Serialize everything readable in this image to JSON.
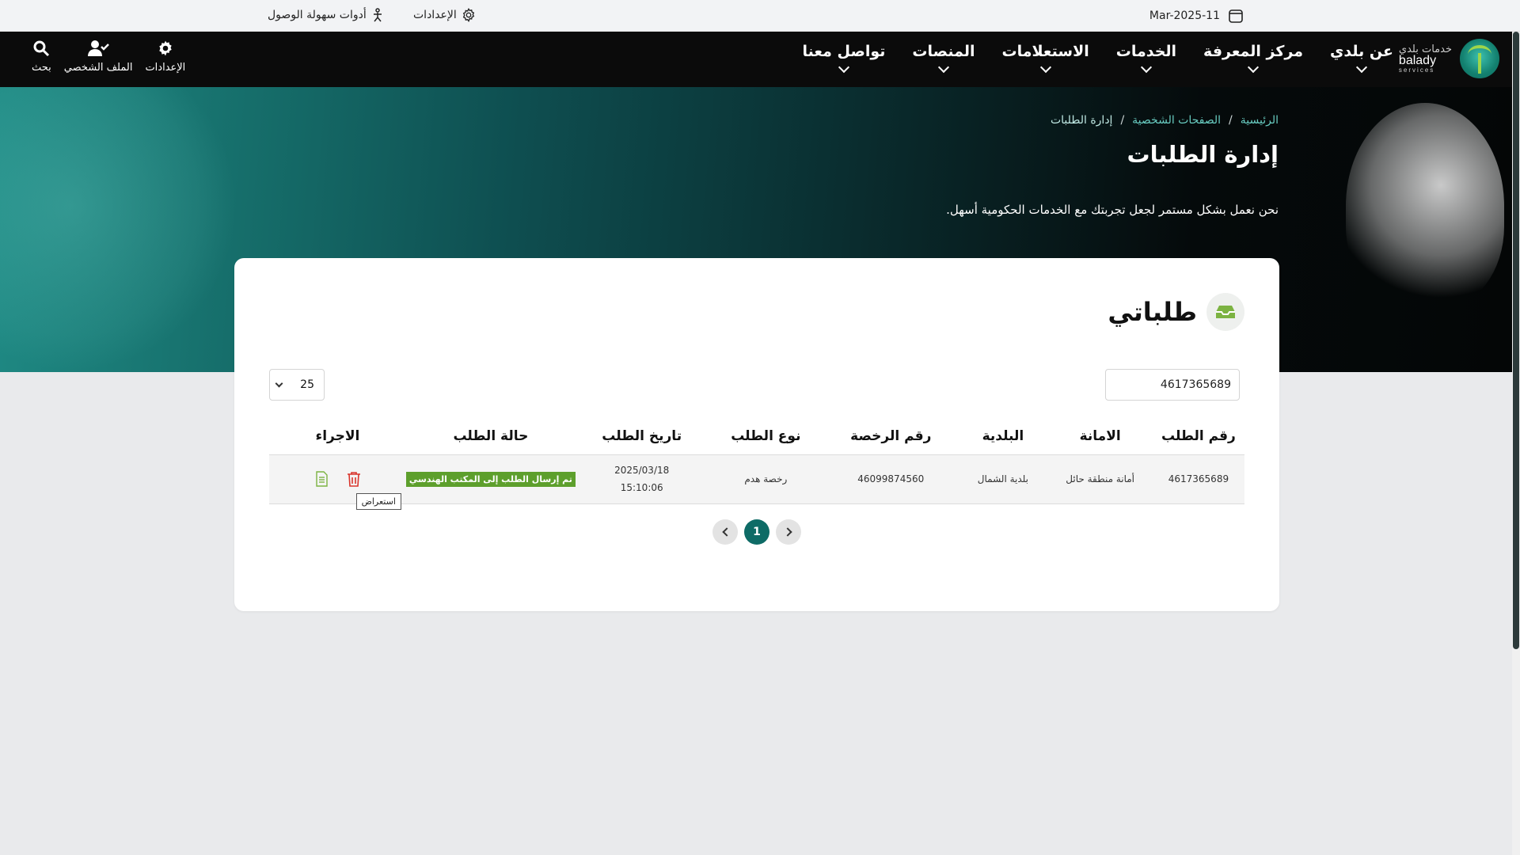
{
  "utility": {
    "date": "Mar-2025-11",
    "settings_label": "الإعدادات",
    "accessibility_label": "أدوات سهولة الوصول"
  },
  "brand": {
    "arabic": "خدمات بلدي",
    "english": "balady",
    "sub": "services"
  },
  "nav": {
    "items": [
      {
        "label": "عن بلدي"
      },
      {
        "label": "مركز المعرفة"
      },
      {
        "label": "الخدمات"
      },
      {
        "label": "الاستعلامات"
      },
      {
        "label": "المنصات"
      },
      {
        "label": "تواصل معنا"
      }
    ],
    "tools": {
      "search": "بحث",
      "profile": "الملف الشخصي",
      "settings": "الإعدادات"
    }
  },
  "hero": {
    "breadcrumb": [
      "الرئيسية",
      "الصفحات الشخصية",
      "إدارة الطلبات"
    ],
    "title": "إدارة الطلبات",
    "subtitle": "نحن نعمل بشكل مستمر لجعل تجربتك مع الخدمات الحكومية أسهل."
  },
  "card": {
    "title": "طلباتي",
    "search_value": "4617365689",
    "page_size": "25",
    "columns": [
      "رقم الطلب",
      "الامانة",
      "البلدية",
      "رقم الرخصة",
      "نوع الطلب",
      "تاريخ الطلب",
      "حالة الطلب",
      "الاجراء"
    ],
    "rows": [
      {
        "request_no": "4617365689",
        "amanah": "أمانة منطقة حائل",
        "municipality": "بلدية الشمال",
        "license_no": "46099874560",
        "type": "رخصة هدم",
        "date": "2025/03/18",
        "time": "15:10:06",
        "status": "تم إرسال الطلب إلى المكتب الهندسي"
      }
    ],
    "tooltip": "استعراض",
    "pagination": {
      "current": "1"
    }
  },
  "colors": {
    "accent": "#0e6b66",
    "status_green": "#5d9f2c",
    "delete_red": "#d9342b",
    "view_green": "#7cb342"
  },
  "icons": [
    "calendar-icon",
    "gear-icon",
    "accessibility-icon",
    "search-icon",
    "user-check-icon",
    "inbox-icon",
    "trash-icon",
    "document-icon",
    "chevron-left-icon",
    "chevron-right-icon"
  ]
}
